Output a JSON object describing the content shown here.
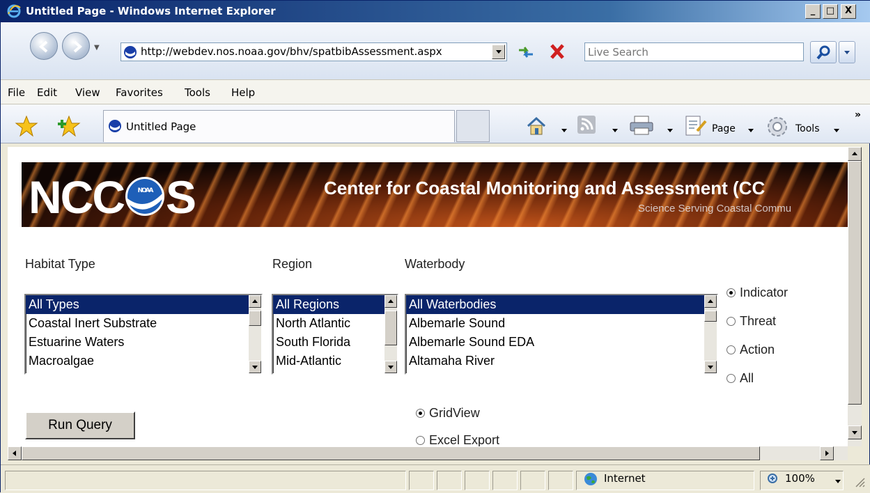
{
  "window": {
    "title": "Untitled Page - Windows Internet Explorer",
    "min": "_",
    "max": "□",
    "close": "X"
  },
  "address": {
    "url": "http://webdev.nos.noaa.gov/bhv/spatbibAssessment.aspx",
    "search_placeholder": "Live Search"
  },
  "menu": [
    "File",
    "Edit",
    "View",
    "Favorites",
    "Tools",
    "Help"
  ],
  "tab": {
    "label": "Untitled Page"
  },
  "command": {
    "page_label": "Page",
    "tools_label": "Tools",
    "overflow": "»"
  },
  "banner": {
    "logo_text_left": "NCC",
    "logo_text_right": "S",
    "noaa": "NOAA",
    "title": "Center for Coastal Monitoring and Assessment (CC",
    "tagline": "Science Serving Coastal Commu"
  },
  "form": {
    "habitat_label": "Habitat Type",
    "region_label": "Region",
    "waterbody_label": "Waterbody",
    "habitat_options": [
      "All Types",
      "Coastal Inert Substrate",
      "Estuarine Waters",
      "Macroalgae"
    ],
    "region_options": [
      "All Regions",
      "North Atlantic",
      "South Florida",
      "Mid-Atlantic"
    ],
    "waterbody_options": [
      "All Waterbodies",
      "Albemarle Sound",
      "Albemarle Sound EDA",
      "Altamaha River"
    ],
    "type_options": [
      "Indicator",
      "Threat",
      "Action",
      "All"
    ],
    "type_selected": "Indicator",
    "output_options": [
      "GridView",
      "Excel Export"
    ],
    "output_selected": "GridView",
    "run_label": "Run Query"
  },
  "status": {
    "zone": "Internet",
    "zoom": "100%"
  }
}
